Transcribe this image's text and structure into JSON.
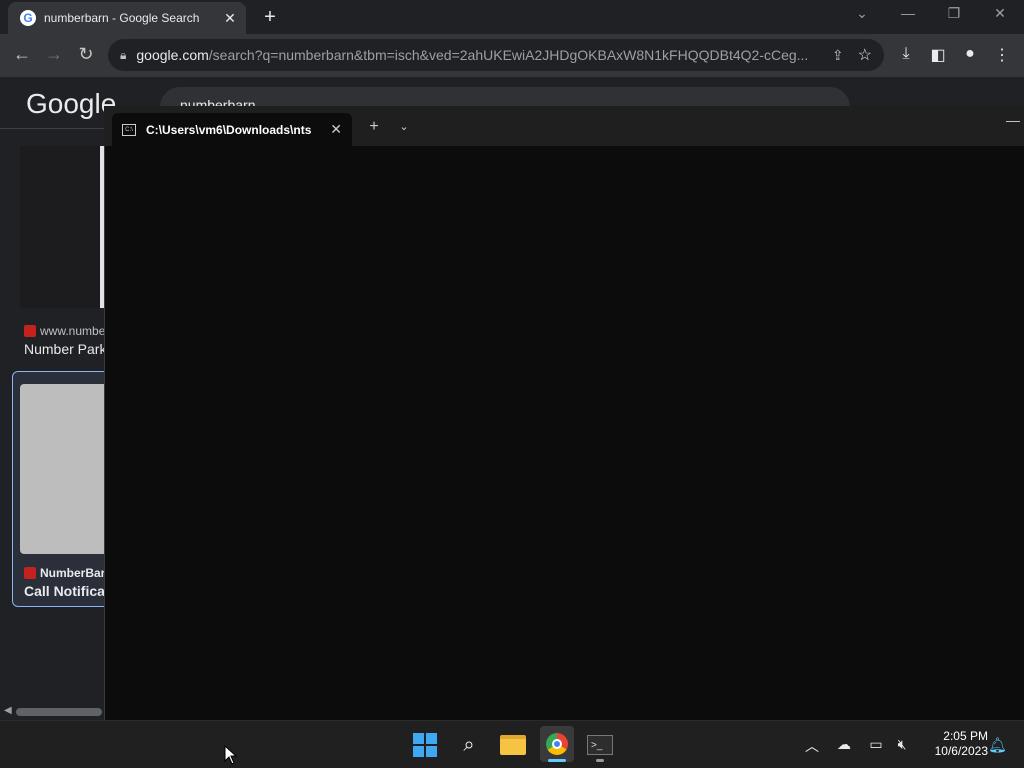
{
  "browser": {
    "tab_title": "numberbarn - Google Search",
    "tab_favicon": "G",
    "new_tab": "+",
    "tab_close": "✕",
    "address": {
      "host": "google.com",
      "rest": "/search?q=numberbarn&tbm=isch&ved=2ahUKEwiA2JHDgOKBAxW8N1kFHQQDBt4Q2-cCeg..."
    }
  },
  "google": {
    "logo": "Google",
    "search_value": "numberbarn",
    "results": [
      {
        "source": "www.numbe",
        "caption": "Number Park"
      },
      {
        "source": "NumberBarn",
        "caption": "Call Notificat"
      }
    ]
  },
  "terminal": {
    "tab_title": "C:\\Users\\vm6\\Downloads\\nts",
    "tab_icon_text": "C:\\"
  },
  "taskbar": {
    "clock_time": "2:05 PM",
    "clock_date": "10/6/2023",
    "terminal_icon_text": ">_"
  },
  "colors": {
    "accent": "#8ab4f8",
    "windows_blue": "#3fa8f4",
    "terminal_bg": "#0c0c0c"
  }
}
